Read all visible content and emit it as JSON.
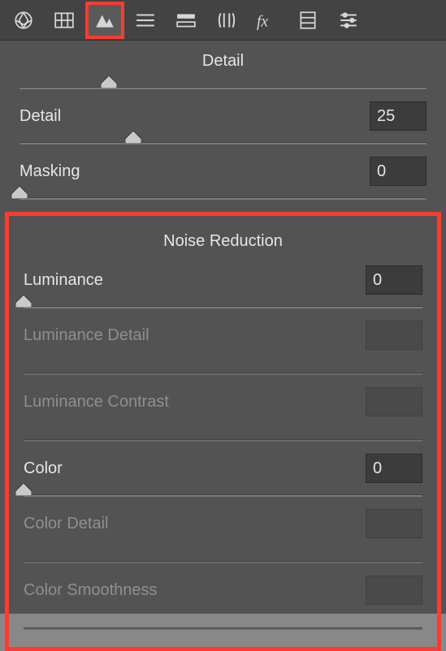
{
  "toolbar": {
    "selected_index": 2
  },
  "sections": {
    "detail_title": "Detail",
    "noise_title": "Noise Reduction"
  },
  "controls": {
    "top_unlabeled": {
      "pos": 22
    },
    "detail": {
      "label": "Detail",
      "value": "25",
      "pos": 28,
      "enabled": true
    },
    "masking": {
      "label": "Masking",
      "value": "0",
      "pos": 0,
      "enabled": true
    },
    "luminance": {
      "label": "Luminance",
      "value": "0",
      "pos": 0,
      "enabled": true
    },
    "lum_detail": {
      "label": "Luminance Detail",
      "value": "",
      "pos": null,
      "enabled": false
    },
    "lum_contrast": {
      "label": "Luminance Contrast",
      "value": "",
      "pos": null,
      "enabled": false
    },
    "color": {
      "label": "Color",
      "value": "0",
      "pos": 0,
      "enabled": true
    },
    "color_detail": {
      "label": "Color Detail",
      "value": "",
      "pos": null,
      "enabled": false
    },
    "color_smooth": {
      "label": "Color Smoothness",
      "value": "",
      "pos": null,
      "enabled": false
    }
  }
}
